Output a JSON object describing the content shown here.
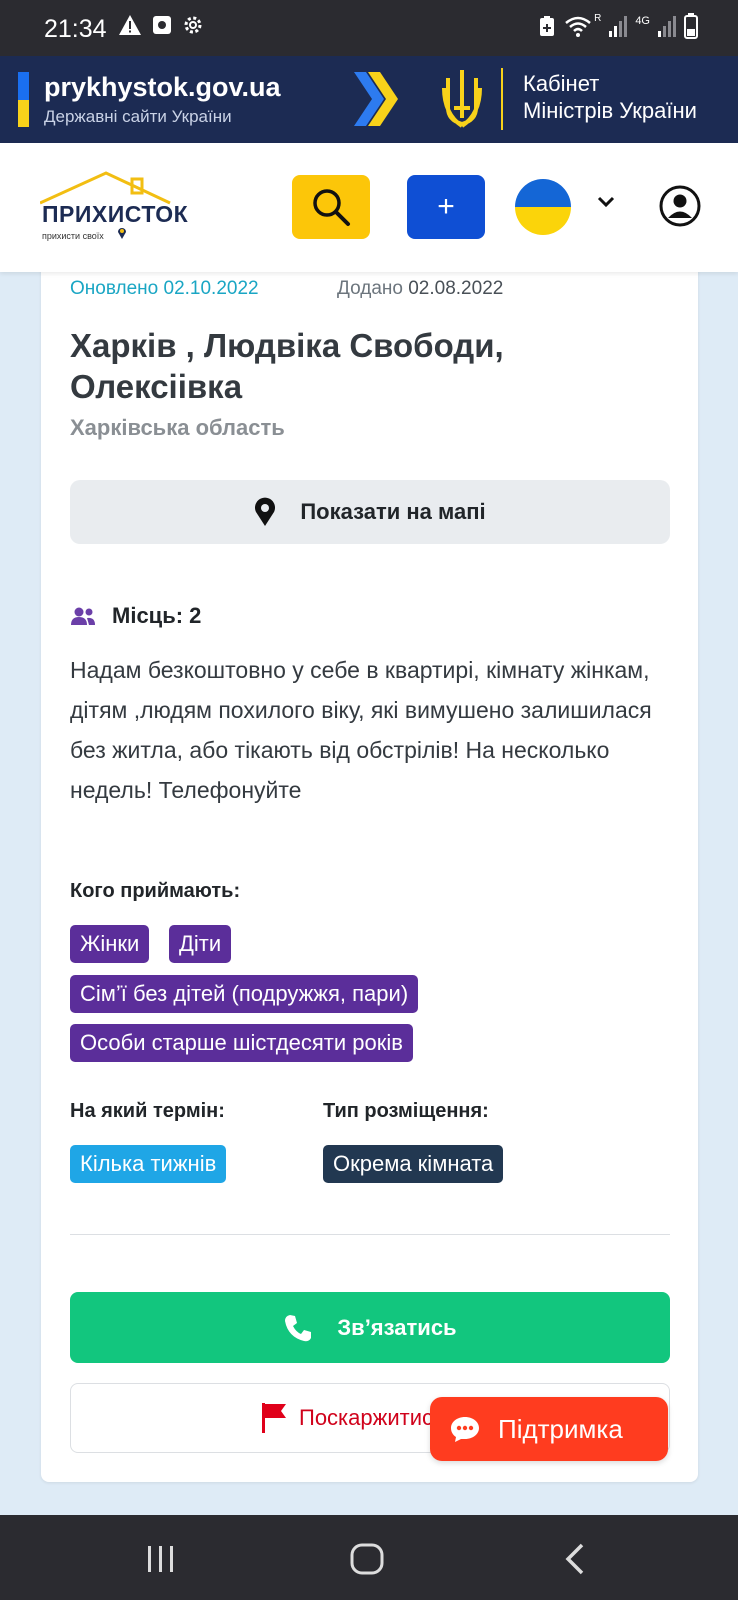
{
  "status_bar": {
    "time": "21:34",
    "left_icons": [
      "warning-icon",
      "notification-icon",
      "settings-icon"
    ],
    "right_icons": [
      "data-saver-icon",
      "wifi-icon",
      "signal-icon",
      "battery-icon"
    ],
    "network_r": "R",
    "network_label": "4G"
  },
  "gov_banner": {
    "domain": "prykhystok.gov.ua",
    "subtitle": "Державні сайти України",
    "cabinet_line1": "Кабінет",
    "cabinet_line2": "Міністрів України",
    "colors": {
      "background": "#1c2b53",
      "accent_yellow": "#f8d21a",
      "accent_blue": "#1a6ff0"
    }
  },
  "header": {
    "logo_text": "ПРИХИСТОК",
    "logo_tagline": "прихисти своїх",
    "search_icon": "search-icon",
    "add_label": "+",
    "language_flag": "ukraine-flag",
    "colors": {
      "search_button": "#fcc609",
      "add_button": "#0f4fd4"
    }
  },
  "listing": {
    "updated_label": "Оновлено",
    "updated_date": "02.10.2022",
    "added_label": "Додано",
    "added_date": "02.08.2022",
    "title": "Харків , Людвіка Свободи, Олексіівка",
    "region": "Харківська область",
    "map_button_label": "Показати на мапі",
    "places_label": "Місць: 2",
    "description": "Надам безкоштовно у себе в квартирі, кімнату жінкам, дітям ,людям похилого віку, які вимушено залишилася без житла, або тікають від обстрілів! На несколько недель! Телефонуйте",
    "who_label": "Кого приймають:",
    "who_tags": [
      "Жінки",
      "Діти",
      "Сім’ї без дітей (подружжя, пари)",
      "Особи старше шістдесяти років"
    ],
    "term_label": "На який термін:",
    "term_value": "Кілька тижнів",
    "type_label": "Тип розміщення:",
    "type_value": "Окрема кімната",
    "contact_label": "Зв’язатись",
    "report_label": "Поскаржитись",
    "colors": {
      "tag_purple": "#5b2e9a",
      "term_blue": "#1fa6e6",
      "type_navy": "#223851",
      "contact_green": "#12c67e",
      "report_red": "#d0021b"
    }
  },
  "support": {
    "label": "Підтримка",
    "color": "#ff3c1f"
  },
  "nav_bar": {
    "buttons": [
      "recent-apps-icon",
      "home-icon",
      "back-icon"
    ]
  }
}
